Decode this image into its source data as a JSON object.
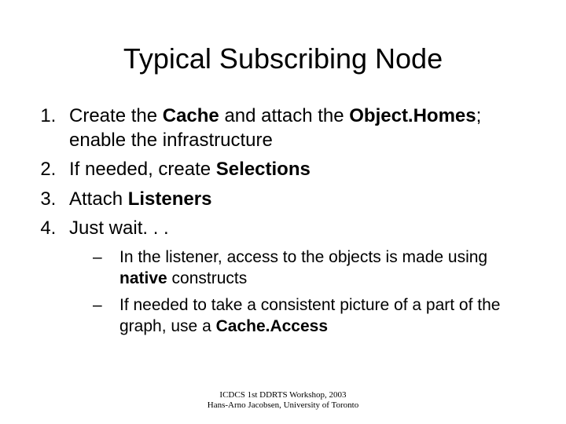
{
  "title": "Typical Subscribing Node",
  "items": [
    {
      "pre1": "Create the ",
      "bold1": "Cache",
      "mid": " and attach the ",
      "bold2": "Object.Homes",
      "post": "; enable the infrastructure"
    },
    {
      "pre1": "If needed, create ",
      "bold1": "Selections"
    },
    {
      "pre1": "Attach ",
      "bold1": "Listeners"
    },
    {
      "pre1": "Just wait. . ."
    }
  ],
  "sub": [
    {
      "pre": "In the listener, access to the objects is made using ",
      "bold": "native",
      "post": " constructs"
    },
    {
      "pre": "If needed to take a consistent picture of a part of the graph, use a ",
      "bold": "Cache.Access"
    }
  ],
  "footer": {
    "line1": "ICDCS 1st DDRTS Workshop, 2003",
    "line2": "Hans-Arno Jacobsen, University of Toronto"
  }
}
